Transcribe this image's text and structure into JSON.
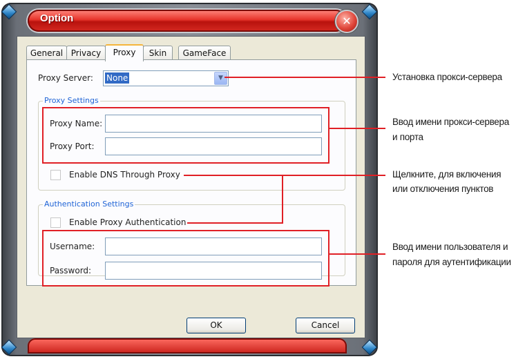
{
  "window": {
    "title": "Option",
    "close_symbol": "✕"
  },
  "tabs": [
    {
      "label": "General"
    },
    {
      "label": "Privacy"
    },
    {
      "label": "Proxy",
      "active": true
    },
    {
      "label": "Skin"
    },
    {
      "label": "GameFace"
    }
  ],
  "proxy_server": {
    "label": "Proxy Server:",
    "value": "None",
    "dropdown_symbol": "▼"
  },
  "proxy_settings": {
    "group_title": "Proxy Settings",
    "name_label": "Proxy Name:",
    "name_value": "",
    "port_label": "Proxy Port:",
    "port_value": "",
    "dns_checkbox_label": "Enable DNS Through Proxy",
    "dns_checked": false
  },
  "auth_settings": {
    "group_title": "Authentication Settings",
    "auth_checkbox_label": "Enable Proxy Authentication",
    "auth_checked": false,
    "username_label": "Username:",
    "username_value": "",
    "password_label": "Password:",
    "password_value": ""
  },
  "buttons": {
    "ok": "OK",
    "cancel": "Cancel"
  },
  "annotations": {
    "proxy_server": "Установка прокси-сервера",
    "proxy_name_line1": "Ввод имени прокси-сервера",
    "proxy_name_line2": "и порта",
    "checkbox_line1": "Щелкните, для включения",
    "checkbox_line2": "или отключения пунктов",
    "credentials_line1": "Ввод имени пользователя и",
    "credentials_line2": "пароля для аутентификации"
  },
  "colors": {
    "callout_red": "#e01f25",
    "group_title_blue": "#1e63d6",
    "title_bar_red": "#e8352c",
    "tab_active_accent": "#f5b53b"
  }
}
